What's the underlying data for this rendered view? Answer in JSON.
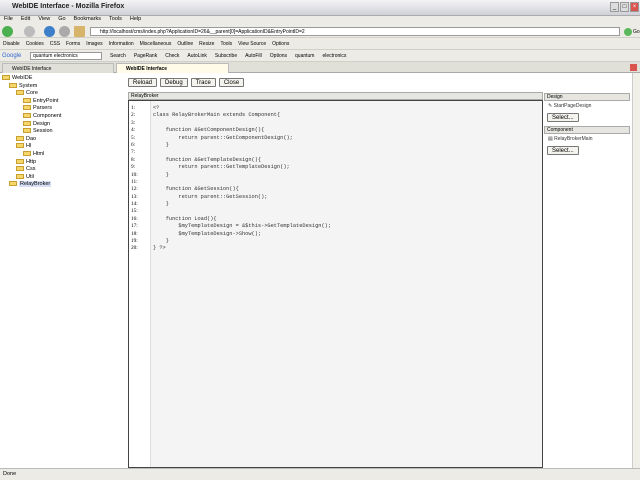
{
  "window": {
    "title": "WebIDE Interface - Mozilla Firefox"
  },
  "menu": [
    "File",
    "Edit",
    "View",
    "Go",
    "Bookmarks",
    "Tools",
    "Help"
  ],
  "nav": {
    "url": "http://localhost/cms/index.php?ApplicationID=26&__parent[0]=ApplicationID&EntryPointID=2",
    "go_label": "Go"
  },
  "toolbar": [
    "Disable",
    "Cookies",
    "CSS",
    "Forms",
    "Images",
    "Information",
    "Miscellaneous",
    "Outline",
    "Resize",
    "Tools",
    "View Source",
    "Options"
  ],
  "googlebar": {
    "logo": "Google",
    "query": "quantum electronics",
    "items": [
      "Search",
      "PageRank",
      "Check",
      "AutoLink",
      "Subscribe",
      "AutoFill",
      "Options",
      "quantum",
      "electronics"
    ]
  },
  "tabs": [
    "WebIDE Interface",
    "WebIDE Interface"
  ],
  "tree": [
    {
      "label": "WebIDE",
      "level": 0
    },
    {
      "label": "System",
      "level": 1
    },
    {
      "label": "Core",
      "level": 2
    },
    {
      "label": "EntryPoint",
      "level": 3
    },
    {
      "label": "Parsers",
      "level": 3
    },
    {
      "label": "Component",
      "level": 3
    },
    {
      "label": "Design",
      "level": 3
    },
    {
      "label": "Session",
      "level": 3
    },
    {
      "label": "Dao",
      "level": 2
    },
    {
      "label": "Hl",
      "level": 2
    },
    {
      "label": "Html",
      "level": 3
    },
    {
      "label": "Http",
      "level": 2
    },
    {
      "label": "Css",
      "level": 2
    },
    {
      "label": "Util",
      "level": 2
    },
    {
      "label": "RelayBroker",
      "level": 1,
      "selected": true
    }
  ],
  "buttons": {
    "reload": "Reload",
    "debug": "Debug",
    "trace": "Trace",
    "close": "Close"
  },
  "editor": {
    "title": "RelayBroker",
    "lines": [
      "<?",
      "class RelayBrokerMain extends Component{",
      "",
      "    function &GetComponentDesign(){",
      "        return parent::GetComponentDesign();",
      "    }",
      "",
      "    function &GetTemplateDesign(){",
      "        return parent::GetTemplateDesign();",
      "    }",
      "",
      "    function &GetSession(){",
      "        return parent::GetSession();",
      "    }",
      "",
      "    function Load(){",
      "        $myTemplateDesign = &$this->GetTemplateDesign();",
      "        $myTemplateDesign->Show();",
      "    }",
      "} ?>"
    ]
  },
  "right": {
    "design_header": "Design",
    "design_item": "StartPageDesign",
    "component_header": "Component",
    "component_item": "RelayBrokerMain",
    "select_label": "Select..."
  },
  "status": "Done"
}
